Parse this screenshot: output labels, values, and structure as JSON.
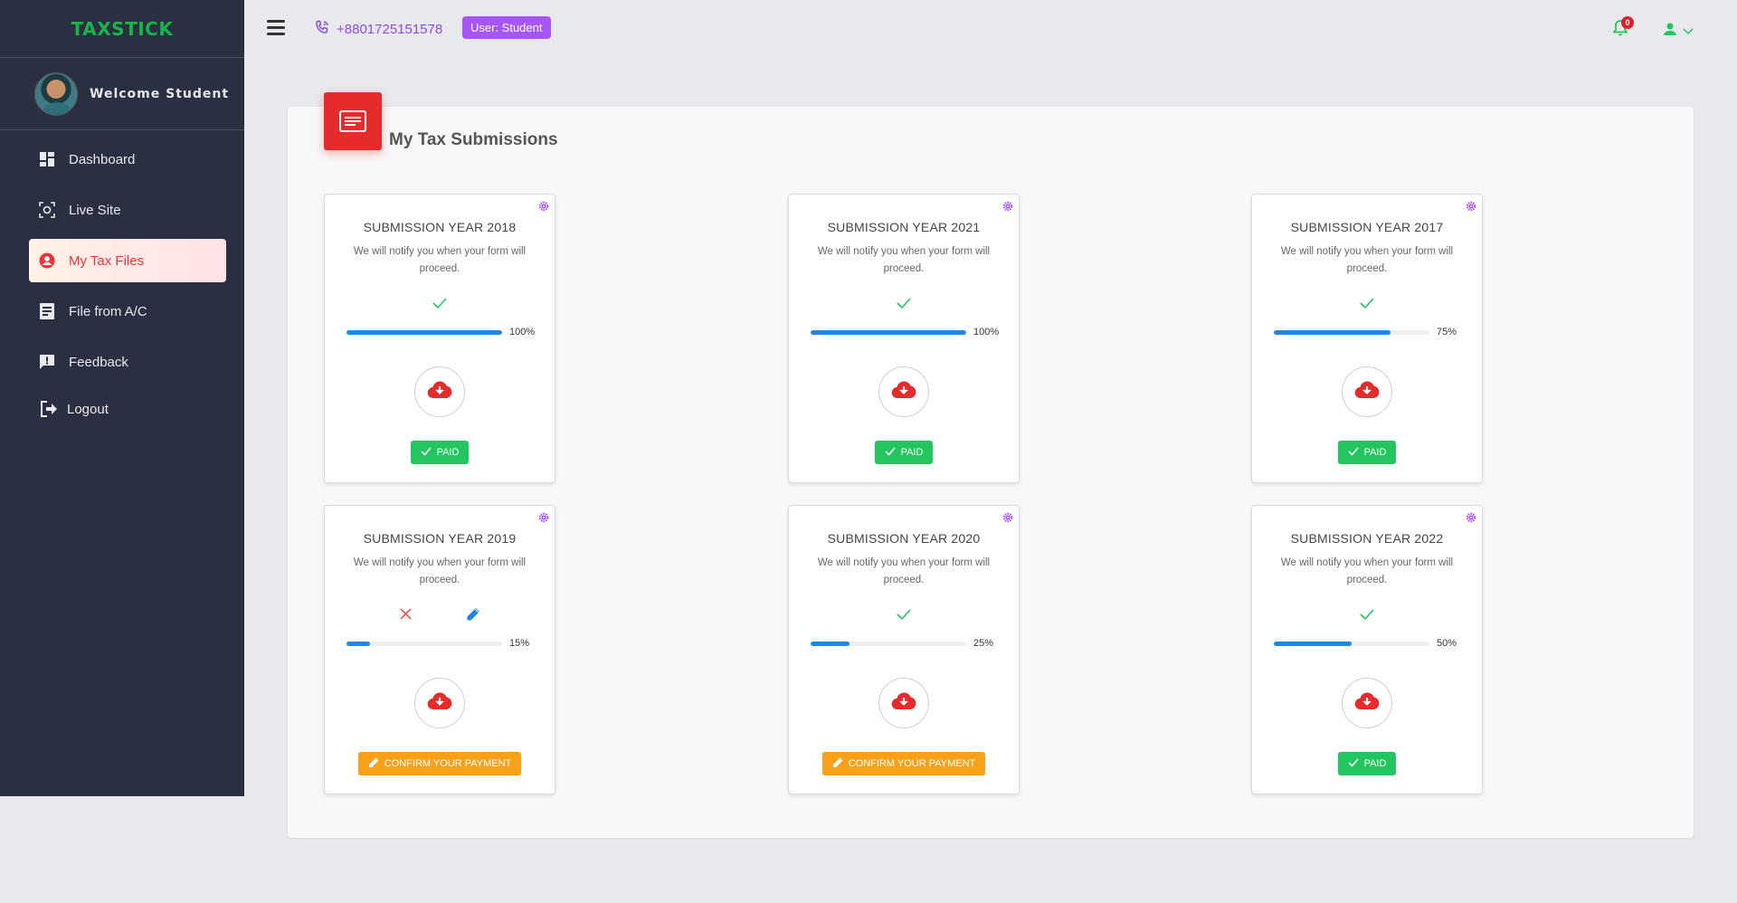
{
  "sidebar": {
    "logo": "TAXSTICK",
    "welcome": "Welcome Student",
    "items": [
      {
        "label": "Dashboard",
        "icon": "dashboard-icon"
      },
      {
        "label": "Live Site",
        "icon": "live-site-icon"
      },
      {
        "label": "My Tax Files",
        "icon": "user-circle-icon",
        "active": true
      },
      {
        "label": "File from A/C",
        "icon": "file-icon"
      },
      {
        "label": "Feedback",
        "icon": "feedback-icon"
      }
    ],
    "logout": "Logout"
  },
  "header": {
    "phone": "+8801725151578",
    "user_badge": "User:  Student",
    "notification_count": "0"
  },
  "main": {
    "title": "My Tax Submissions",
    "submissions": [
      {
        "title": "SUBMISSION YEAR 2018",
        "desc": "We will notify you when your form will proceed.",
        "progress": 100,
        "progress_label": "100%",
        "status": "PAID",
        "status_type": "paid",
        "icons": [
          "check"
        ]
      },
      {
        "title": "SUBMISSION YEAR 2021",
        "desc": "We will notify you when your form will proceed.",
        "progress": 100,
        "progress_label": "100%",
        "status": "PAID",
        "status_type": "paid",
        "icons": [
          "check"
        ]
      },
      {
        "title": "SUBMISSION YEAR 2017",
        "desc": "We will notify you when your form will proceed.",
        "progress": 75,
        "progress_label": "75%",
        "status": "PAID",
        "status_type": "paid",
        "icons": [
          "check"
        ]
      },
      {
        "title": "SUBMISSION YEAR 2019",
        "desc": "We will notify you when your form will proceed.",
        "progress": 15,
        "progress_label": "15%",
        "status": "CONFIRM YOUR PAYMENT",
        "status_type": "confirm",
        "icons": [
          "cross",
          "pencil"
        ]
      },
      {
        "title": "SUBMISSION YEAR 2020",
        "desc": "We will notify you when your form will proceed.",
        "progress": 25,
        "progress_label": "25%",
        "status": "CONFIRM YOUR PAYMENT",
        "status_type": "confirm",
        "icons": [
          "check"
        ]
      },
      {
        "title": "SUBMISSION YEAR 2022",
        "desc": "We will notify you when your form will proceed.",
        "progress": 50,
        "progress_label": "50%",
        "status": "PAID",
        "status_type": "paid",
        "icons": [
          "check"
        ]
      }
    ]
  },
  "colors": {
    "sidebar_bg": "#2a2f41",
    "accent_red": "#e52b2b",
    "paid_green": "#22c55e",
    "confirm_orange": "#f7a11a",
    "progress_blue": "#1e88e5",
    "badge_purple": "#a855f7"
  }
}
